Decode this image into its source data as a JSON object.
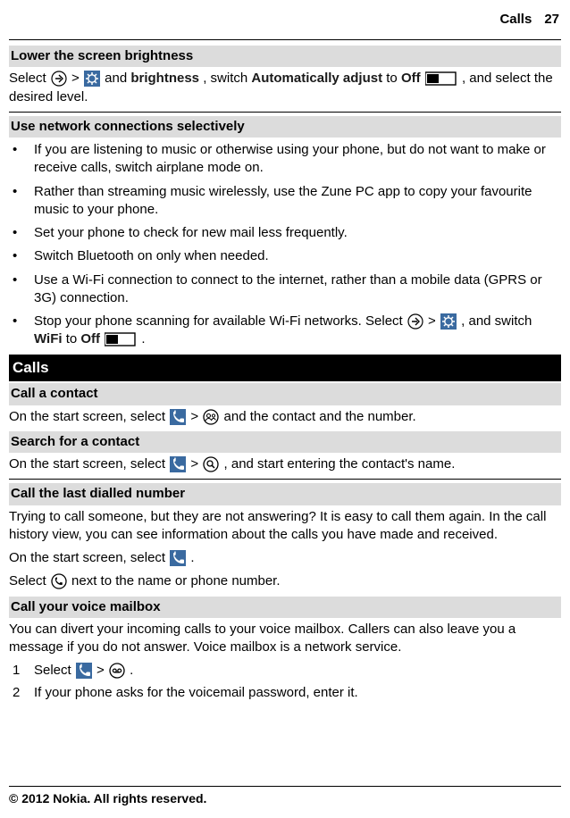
{
  "header": {
    "section": "Calls",
    "page": "27"
  },
  "s1": {
    "title": "Lower the screen brightness",
    "p_a": "Select ",
    "p_b": " > ",
    "p_c": " and ",
    "brightness": "brightness",
    "p_d": ", switch ",
    "auto": "Automatically adjust",
    "p_e": " to ",
    "off": "Off",
    "p_f": " , and select the desired level."
  },
  "s2": {
    "title": "Use network connections selectively",
    "b1": "If you are listening to music or otherwise using your phone, but do not want to make or receive calls, switch airplane mode on.",
    "b2": "Rather than streaming music wirelessly, use the Zune PC app to copy your favourite music to your phone.",
    "b3": "Set your phone to check for new mail less frequently.",
    "b4": "Switch Bluetooth on only when needed.",
    "b5": "Use a Wi-Fi connection to connect to the internet, rather than a mobile data (GPRS or 3G) connection.",
    "b6_a": "Stop your phone scanning for available Wi-Fi networks. Select ",
    "b6_b": " > ",
    "b6_c": ", and switch ",
    "wifi": "WiFi",
    "b6_d": " to ",
    "off": "Off",
    "b6_e": " ."
  },
  "s3": {
    "title": "Calls"
  },
  "s4": {
    "title": "Call a contact",
    "p_a": "On the start screen, select ",
    "p_b": " > ",
    "p_c": " and the contact and the number."
  },
  "s5": {
    "title": "Search for a contact",
    "p_a": "On the start screen, select ",
    "p_b": " > ",
    "p_c": ", and start entering the contact's name."
  },
  "s6": {
    "title": "Call the last dialled number",
    "p1": "Trying to call someone, but they are not answering? It is easy to call them again. In the call history view, you can see information about the calls you have made and received.",
    "p2_a": "On the start screen, select ",
    "p2_b": ".",
    "p3_a": "Select ",
    "p3_b": " next to the name or phone number."
  },
  "s7": {
    "title": "Call your voice mailbox",
    "p1": "You can divert your incoming calls to your voice mailbox. Callers can also leave you a message if you do not answer. Voice mailbox is a network service.",
    "step1_a": "Select ",
    "step1_b": " > ",
    "step1_c": ".",
    "step2": "If your phone asks for the voicemail password, enter it."
  },
  "footer": "© 2012 Nokia. All rights reserved."
}
